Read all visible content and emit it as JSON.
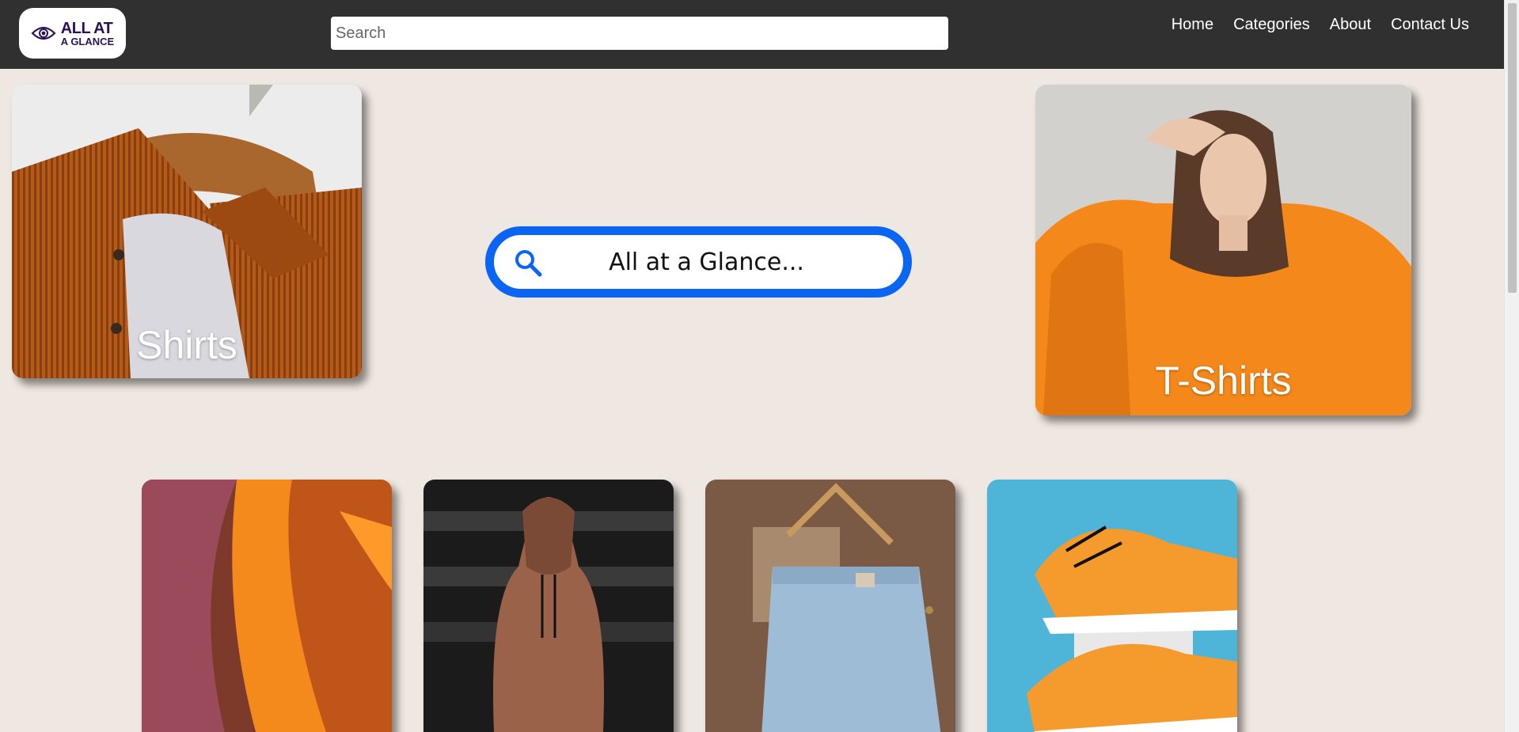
{
  "header": {
    "logo_line1": "ALL AT",
    "logo_line2": "A GLANCE",
    "search_placeholder": "Search",
    "nav": [
      "Home",
      "Categories",
      "About",
      "Contact Us"
    ]
  },
  "hero": {
    "search_text": "All at a Glance..."
  },
  "categories": {
    "featured": [
      {
        "label": "Shirts"
      },
      {
        "label": "T-Shirts"
      }
    ],
    "row_images": [
      "silk-scarf",
      "hoodie",
      "jeans",
      "sneakers"
    ]
  },
  "colors": {
    "header_bg": "#303030",
    "page_bg": "#efe7e1",
    "accent_blue": "#0a66f2",
    "logo_purple": "#2b1255"
  },
  "icons": [
    "eye-icon",
    "search-icon"
  ]
}
